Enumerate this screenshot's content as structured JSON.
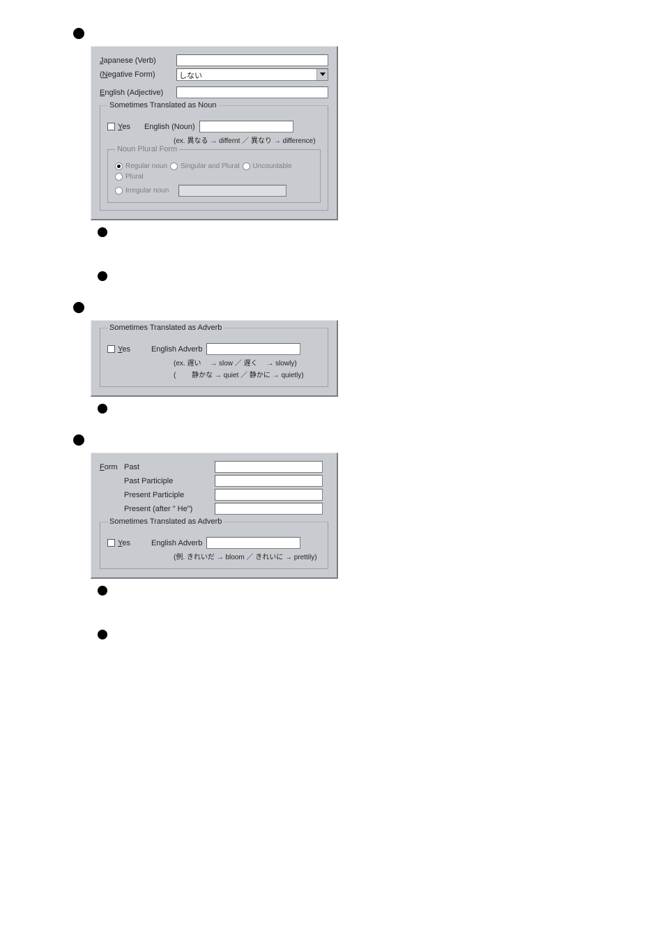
{
  "sec1": {
    "title": "",
    "panel": {
      "japanese_verb_label": {
        "pre": "",
        "acc": "J",
        "post": "apanese (Verb)"
      },
      "negative_form_label": {
        "pre": "(",
        "acc": "N",
        "post": "egative Form)"
      },
      "negative_form_value": "しない",
      "english_adj_label": {
        "pre": "",
        "acc": "E",
        "post": "nglish (Adjective)"
      },
      "group_noun": {
        "title": "Sometimes Translated as Noun",
        "yes_label": {
          "acc": "Y",
          "post": "es"
        },
        "english_noun_label": "English (Noun)",
        "example": "(ex. 異なる → differnt ／ 異なり → difference)",
        "plural_title": "Noun Plural Form",
        "opt_regular": "Regular noun",
        "opt_sp": "Singular and Plural",
        "opt_unc": "Uncountable",
        "opt_plural": "Plural",
        "opt_irr": "Irregular noun"
      }
    },
    "sub1": "",
    "sub2": ""
  },
  "sec2": {
    "title": "",
    "panel": {
      "group_adv": {
        "title": "Sometimes Translated as Adverb",
        "yes_label": {
          "acc": "Y",
          "post": "es"
        },
        "english_adv_label": "English Adverb",
        "ex1": "(ex. 遅い　 → slow ／ 遅く　 → slowly)",
        "ex2": "(　　 静かな → quiet ／ 静かに → quietly)"
      }
    },
    "sub1": ""
  },
  "sec3": {
    "title": "",
    "panel": {
      "form_label": {
        "acc": "F",
        "post": "orm"
      },
      "past": "Past",
      "past_part": "Past Participle",
      "pres_part": "Present Participle",
      "pres_he": "Present (after \" He\")",
      "group_adv": {
        "title": "Sometimes Translated as Adverb",
        "yes_label": {
          "acc": "Y",
          "post": "es"
        },
        "english_adv_label": "English Adverb",
        "ex": "(例. きれいだ → bloom ／ きれいに → prettily)"
      }
    },
    "sub1": "",
    "sub2": ""
  }
}
